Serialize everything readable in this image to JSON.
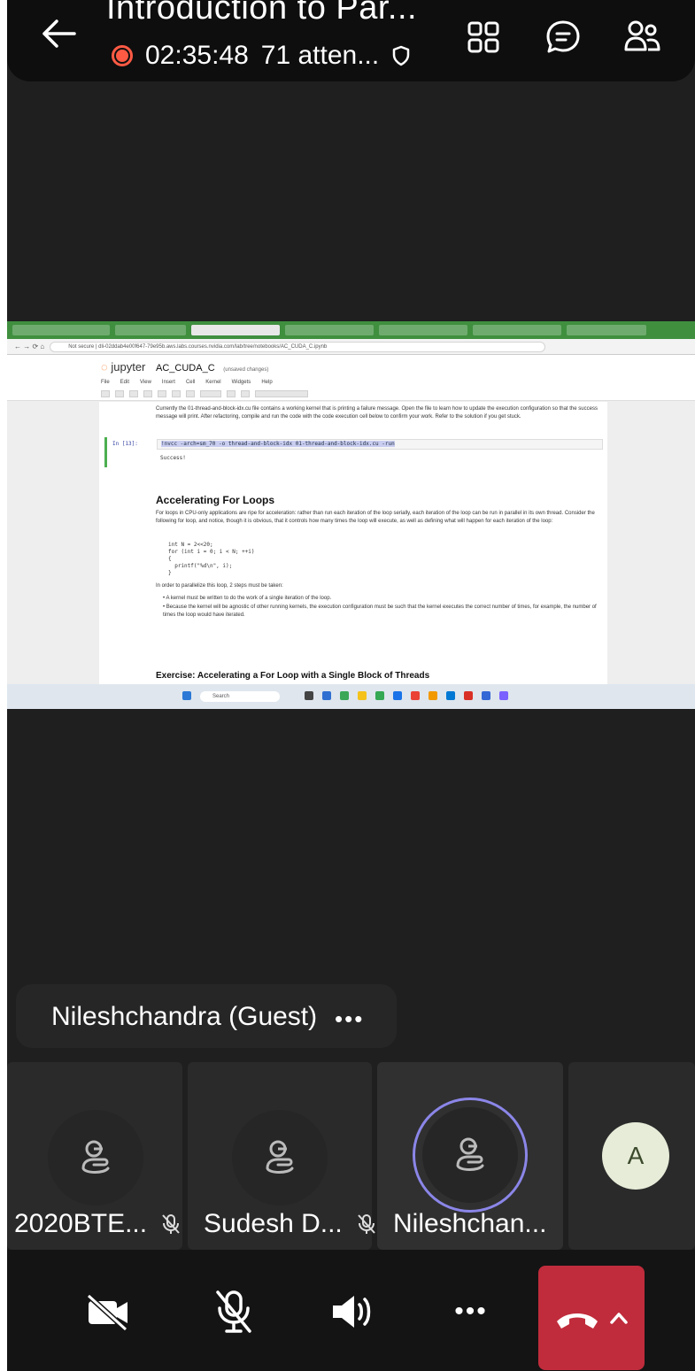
{
  "header": {
    "title": "Introduction to Par...",
    "timer": "02:35:48",
    "attendees": "71 atten..."
  },
  "shared_screen": {
    "address": "Not secure | dli-02ddab4e00f647-79e95b.aws.labs.courses.nvidia.com/lab/tree/notebooks/AC_CUDA_C.ipynb",
    "notebook": {
      "brand": "jupyter",
      "name": "AC_CUDA_C",
      "status": "(unsaved changes)",
      "menu": [
        "File",
        "Edit",
        "View",
        "Insert",
        "Cell",
        "Kernel",
        "Widgets",
        "Help"
      ],
      "intro_text": "Currently the 01-thread-and-block-idx.cu file contains a working kernel that is printing a failure message. Open the file to learn how to update the execution configuration so that the success message will print. After refactoring, compile and run the code with the code execution cell below to confirm your work. Refer to the solution if you get stuck.",
      "cell_prompt": "In [13]:",
      "cell_code": "!nvcc -arch=sm_70 -o thread-and-block-idx 01-thread-and-block-idx.cu -run",
      "cell_output": "Success!",
      "heading": "Accelerating For Loops",
      "paragraph": "For loops in CPU-only applications are ripe for acceleration: rather than run each iteration of the loop serially, each iteration of the loop can be run in parallel in its own thread. Consider the following for loop, and notice, though it is obvious, that it controls how many times the loop will execute, as well as defining what will happen for each iteration of the loop:",
      "code_block": "int N = 2<<20;\nfor (int i = 0; i < N; ++i)\n{\n  printf(\"%d\\n\", i);\n}",
      "steps_intro": "In order to parallelize this loop, 2 steps must be taken:",
      "bullets": [
        "A kernel must be written to do the work of a single iteration of the loop.",
        "Because the kernel will be agnostic of other running kernels, the execution configuration must be such that the kernel executes the correct number of times, for example, the number of times the loop would have iterated."
      ],
      "next_heading": "Exercise: Accelerating a For Loop with a Single Block of Threads"
    },
    "taskbar": {
      "search_label": "Search"
    }
  },
  "participant_bubble": {
    "name": "Nileshchandra (Guest)",
    "more": "•••"
  },
  "tiles": [
    {
      "label": "2020BTE...",
      "muted": true,
      "icon": "guest-icon"
    },
    {
      "label": "Sudesh D...",
      "muted": true,
      "icon": "guest-icon"
    },
    {
      "label": "Nileshchan...",
      "muted": false,
      "icon": "guest-icon",
      "speaking": true
    },
    {
      "label": "",
      "avatar_letter": "A"
    }
  ],
  "controls": {
    "more": "•••"
  },
  "colors": {
    "background": "#1f1f1f",
    "recording": "#ff5a44",
    "speaking_ring": "#8b86e8",
    "hangup": "#c02c3c",
    "avatar_a": "#e6ecd8"
  }
}
